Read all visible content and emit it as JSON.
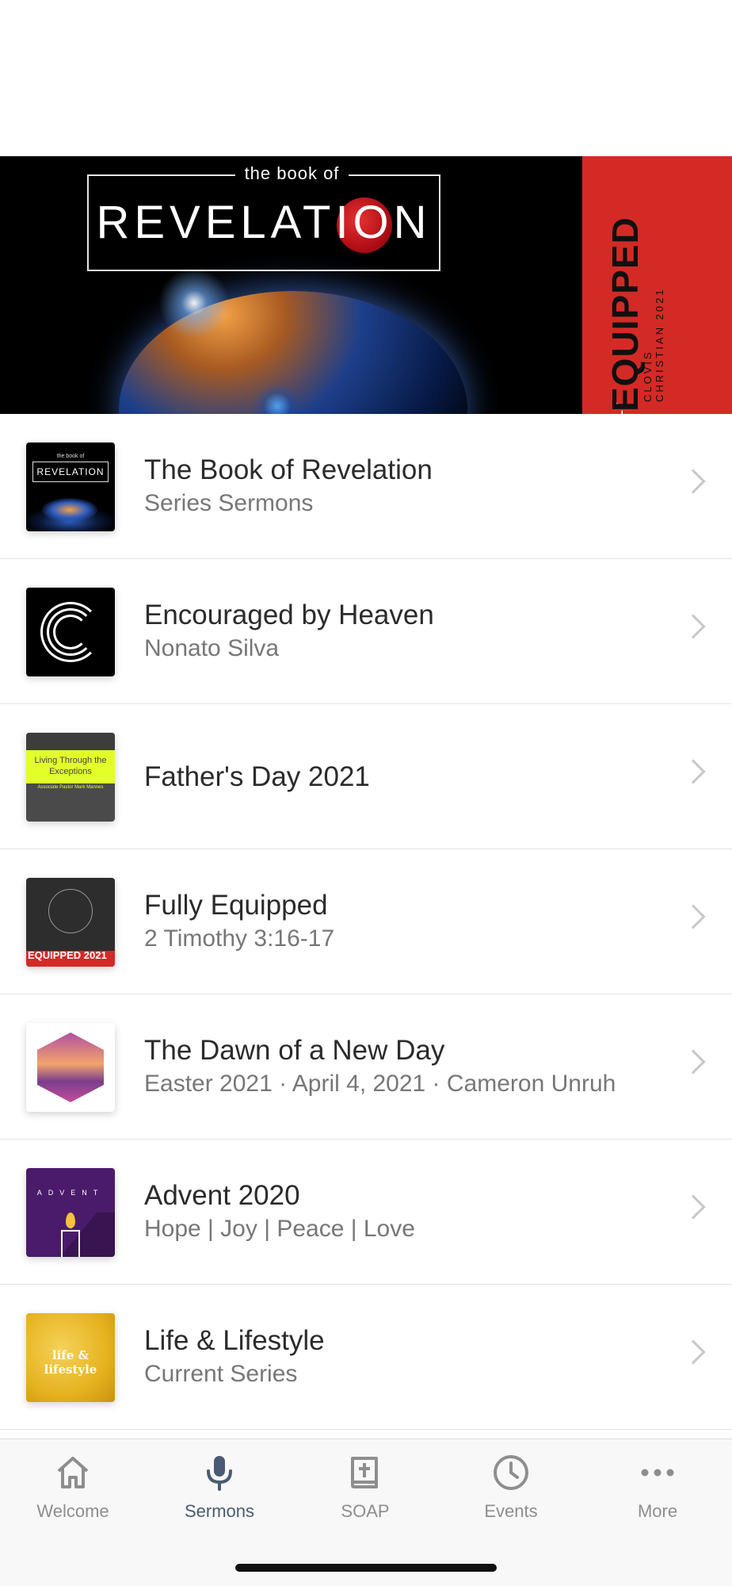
{
  "hero": {
    "subtitle": "the book of",
    "title": "REVELATION",
    "side_fully": "FULLY",
    "side_equipped": "EQUIPPED",
    "side_clovis": "CLOVIS CHRISTIAN 2021"
  },
  "sermons": [
    {
      "title": "The Book of Revelation",
      "subtitle": "Series Sermons",
      "thumb_text": "REVELATION",
      "thumb_top": "the book of"
    },
    {
      "title": "Encouraged by Heaven",
      "subtitle": "Nonato Silva"
    },
    {
      "title": "Father's Day 2021",
      "subtitle": "",
      "thumb_text": "Living Through the Exceptions",
      "thumb_small": "Associate Pastor Mark Mannes"
    },
    {
      "title": "Fully Equipped",
      "subtitle": "2 Timothy 3:16-17",
      "thumb_text": "EQUIPPED 2021"
    },
    {
      "title": "The Dawn of a New Day",
      "subtitle": "Easter 2021 · April 4, 2021 · Cameron Unruh"
    },
    {
      "title": "Advent 2020",
      "subtitle": "Hope | Joy | Peace | Love",
      "thumb_text": "ADVENT"
    },
    {
      "title": "Life & Lifestyle",
      "subtitle": "Current Series",
      "thumb_text": "life & lifestyle"
    }
  ],
  "tabs": [
    {
      "label": "Welcome",
      "icon": "home-icon"
    },
    {
      "label": "Sermons",
      "icon": "microphone-icon"
    },
    {
      "label": "SOAP",
      "icon": "bible-icon"
    },
    {
      "label": "Events",
      "icon": "clock-icon"
    },
    {
      "label": "More",
      "icon": "ellipsis-icon"
    }
  ],
  "colors": {
    "active_tab": "#4a5a73",
    "inactive_tab": "#8e8e8e",
    "banner_red": "#d32a26"
  }
}
